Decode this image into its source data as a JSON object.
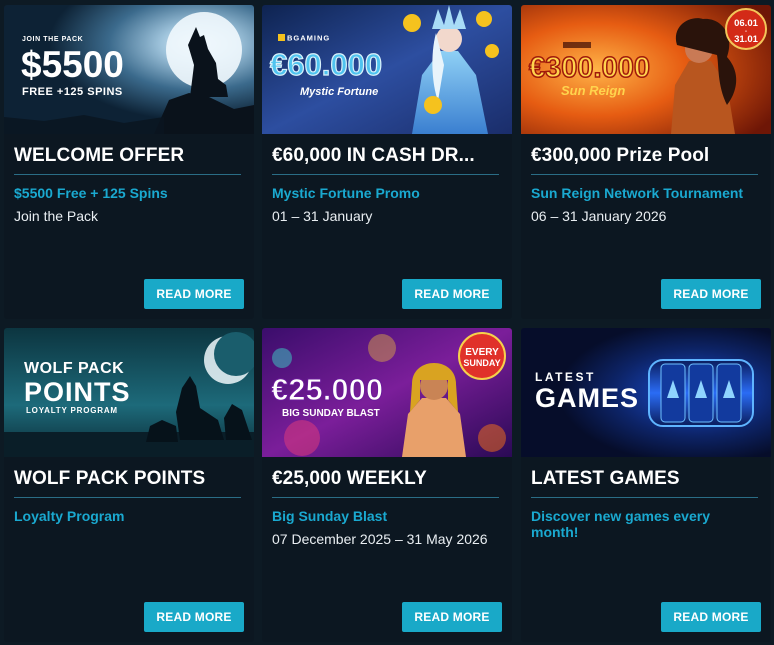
{
  "cards": [
    {
      "banner": {
        "top_text": "JOIN THE PACK",
        "big_text": "$5500",
        "bottom_text": "FREE +125 SPINS"
      },
      "title": "WELCOME OFFER",
      "subtitle": "$5500 Free + 125 Spins",
      "description": "Join the Pack",
      "button": "READ MORE"
    },
    {
      "banner": {
        "brand": "BGAMING",
        "big_text": "€60.000",
        "bottom_text": "Mystic Fortune"
      },
      "title": "€60,000 IN CASH DR...",
      "subtitle": "Mystic Fortune Promo",
      "description": "01 – 31 January",
      "button": "READ MORE"
    },
    {
      "banner": {
        "date_top": "06.01",
        "date_sep": "-",
        "date_bottom": "31.01",
        "big_text": "€300.000",
        "bottom_text": "Sun Reign"
      },
      "title": "€300,000 Prize Pool",
      "subtitle": "Sun Reign Network Tournament",
      "description": "06 – 31 January 2026",
      "button": "READ MORE"
    },
    {
      "banner": {
        "line1": "WOLF PACK",
        "line2": "POINTS",
        "line3": "LOYALTY PROGRAM"
      },
      "title": "WOLF PACK POINTS",
      "subtitle": "Loyalty Program",
      "description": "",
      "button": "READ MORE"
    },
    {
      "banner": {
        "big_text": "€25.000",
        "bottom_text": "BIG SUNDAY BLAST",
        "badge_top": "EVERY",
        "badge_bottom": "SUNDAY"
      },
      "title": "€25,000 WEEKLY",
      "subtitle": "Big Sunday Blast",
      "description": "07 December 2025 – 31 May 2026",
      "button": "READ MORE"
    },
    {
      "banner": {
        "line1": "LATEST",
        "line2": "GAMES"
      },
      "title": "LATEST GAMES",
      "subtitle": "Discover new games every month!",
      "description": "",
      "button": "READ MORE"
    }
  ],
  "colors": {
    "page_bg": "#0d1a24",
    "card_bg": "#0c1721",
    "accent": "#19a9c8",
    "subtitle": "#1aa9d0"
  }
}
